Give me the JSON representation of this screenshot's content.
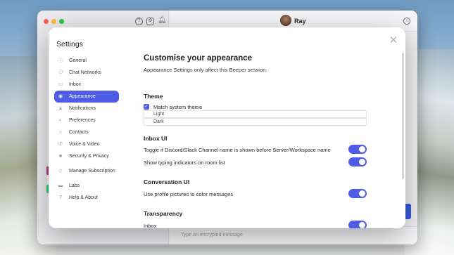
{
  "chat": {
    "contact_name": "Ray",
    "composer_placeholder": "Type an encrypted message"
  },
  "settings": {
    "title": "Settings",
    "close_glyph": "✕",
    "nav": [
      {
        "label": "General",
        "icon": "info-circle-icon",
        "active": false
      },
      {
        "label": "Chat Networks",
        "icon": "chat-bubbles-icon",
        "active": false
      },
      {
        "label": "Inbox",
        "icon": "inbox-icon",
        "active": false
      },
      {
        "label": "Appearance",
        "icon": "eye-icon",
        "active": true
      },
      {
        "label": "Notifications",
        "icon": "bell-icon",
        "active": false
      },
      {
        "label": "Preferences",
        "icon": "toggle-icon",
        "active": false
      },
      {
        "label": "Contacts",
        "icon": "person-circle-icon",
        "active": false
      },
      {
        "label": "Voice & Video",
        "icon": "phone-icon",
        "active": false
      },
      {
        "label": "Security & Privacy",
        "icon": "lock-icon",
        "active": false
      },
      {
        "label": "Manage Subscription",
        "icon": "tag-icon",
        "active": false
      },
      {
        "label": "Labs",
        "icon": "folder-icon",
        "active": false
      },
      {
        "label": "Help & About",
        "icon": "question-circle-icon",
        "active": false
      }
    ],
    "content": {
      "heading": "Customise your appearance",
      "subheading": "Appearance Settings only affect this Beeper session.",
      "theme": {
        "title": "Theme",
        "match_system_label": "Match system theme",
        "match_system_checked": true,
        "options": [
          "Light",
          "Dark"
        ]
      },
      "inbox_ui": {
        "title": "Inbox UI",
        "toggles": [
          {
            "label": "Toggle if Discord/Slack Channel name is shown before Server/Workspace name",
            "on": true
          },
          {
            "label": "Show typing indicators on room list",
            "on": true
          }
        ]
      },
      "conversation_ui": {
        "title": "Conversation UI",
        "toggles": [
          {
            "label": "Use profile pictures to color messages",
            "on": true
          }
        ]
      },
      "transparency": {
        "title": "Transparency",
        "toggles": [
          {
            "label": "Inbox",
            "on": true
          }
        ]
      }
    }
  },
  "colors": {
    "accent": "#4f5ce6",
    "modal_bg": "#ffffff"
  }
}
